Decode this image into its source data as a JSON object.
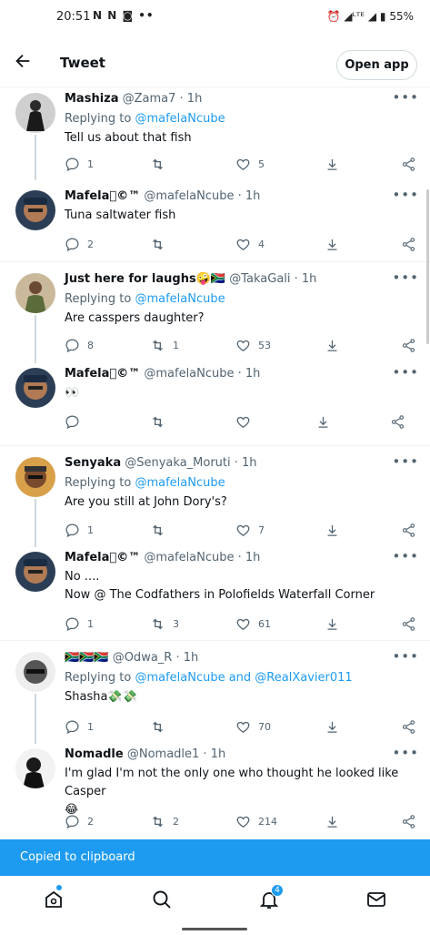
{
  "status": {
    "time": "20:51",
    "left_icons": "N N ◙ ••",
    "right": "⏰ ◢ᴸᵀᴱ ◢ ▮ 55%"
  },
  "header": {
    "title": "Tweet",
    "open_app": "Open app"
  },
  "tweets": [
    {
      "name": "Mashiza",
      "handle": "@Zama7 · 1h",
      "replying_prefix": "Replying to ",
      "replying_to": "@mafelaNcube",
      "text": "Tell us about that fish",
      "replies": "1",
      "retweets": "",
      "likes": "5"
    },
    {
      "name": "Mafela©™",
      "handle": "@mafelaNcube · 1h",
      "text": "Tuna  saltwater fish",
      "replies": "2",
      "retweets": "",
      "likes": "4"
    },
    {
      "name": "Just here for laughs🤪🇿🇦",
      "handle": "@TakaGali · 1h",
      "replying_prefix": "Replying to ",
      "replying_to": "@mafelaNcube",
      "text": "Are casspers daughter?",
      "replies": "8",
      "retweets": "1",
      "likes": "53"
    },
    {
      "name": "Mafela©™",
      "handle": "@mafelaNcube · 1h",
      "text": "👀",
      "replies": "",
      "retweets": "",
      "likes": ""
    },
    {
      "name": "Senyaka",
      "handle": "@Senyaka_Moruti · 1h",
      "replying_prefix": "Replying to ",
      "replying_to": "@mafelaNcube",
      "text": "Are you still at John Dory's?",
      "replies": "1",
      "retweets": "",
      "likes": "7"
    },
    {
      "name": "Mafela©™",
      "handle": "@mafelaNcube · 1h",
      "text": "No ....",
      "text2": " Now @ The Codfathers in Polofields Waterfall Corner",
      "replies": "1",
      "retweets": "3",
      "likes": "61"
    },
    {
      "name": "🇿🇦🇿🇦🇿🇦",
      "handle": "@Odwa_R · 1h",
      "replying_prefix": "Replying to ",
      "replying_to": "@mafelaNcube and @RealXavier011",
      "text": "Shasha💸💸",
      "replies": "1",
      "retweets": "",
      "likes": "70"
    },
    {
      "name": "Nomadle",
      "handle": "@Nomadle1 · 1h",
      "text": "I'm glad I'm not the only one who thought he looked like Casper",
      "text2": "😂",
      "replies": "2",
      "retweets": "2",
      "likes": "214"
    }
  ],
  "toast": "Copied to clipboard",
  "tabs": {
    "notifications_badge": "4"
  },
  "colors": {
    "accent": "#1d9bf0",
    "muted": "#536471"
  }
}
